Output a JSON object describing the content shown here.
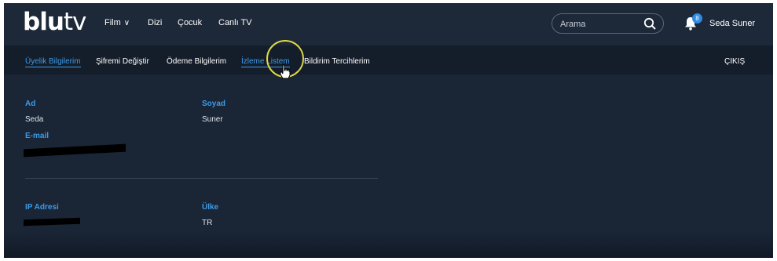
{
  "header": {
    "logo": {
      "bold": "blu",
      "thin": "tv"
    },
    "nav": [
      {
        "label": "Film",
        "has_dropdown": true
      },
      {
        "label": "Dizi"
      },
      {
        "label": "Çocuk"
      },
      {
        "label": "Canlı TV"
      }
    ],
    "search": {
      "placeholder": "Arama",
      "icon": "search-icon"
    },
    "notifications": {
      "icon": "bell-icon",
      "count": "8"
    },
    "user_name": "Seda Suner"
  },
  "subnav": {
    "items": [
      {
        "label": "Üyelik Bilgilerim",
        "active": true
      },
      {
        "label": "Şifremi Değiştir"
      },
      {
        "label": "Ödeme Bilgilerim"
      },
      {
        "label": "İzleme Listem",
        "active": true
      },
      {
        "label": "Bildirim Tercihlerim"
      }
    ],
    "logout": "ÇIKIŞ"
  },
  "profile": {
    "first_name": {
      "label": "Ad",
      "value": "Seda"
    },
    "last_name": {
      "label": "Soyad",
      "value": "Suner"
    },
    "email": {
      "label": "E-mail",
      "value": ""
    },
    "ip": {
      "label": "IP Adresi",
      "value": ""
    },
    "country": {
      "label": "Ülke",
      "value": "TR"
    }
  },
  "colors": {
    "background": "#1a2536",
    "header": "#1d2838",
    "accent": "#3d9be9",
    "cursor_highlight": "#dcd848"
  }
}
